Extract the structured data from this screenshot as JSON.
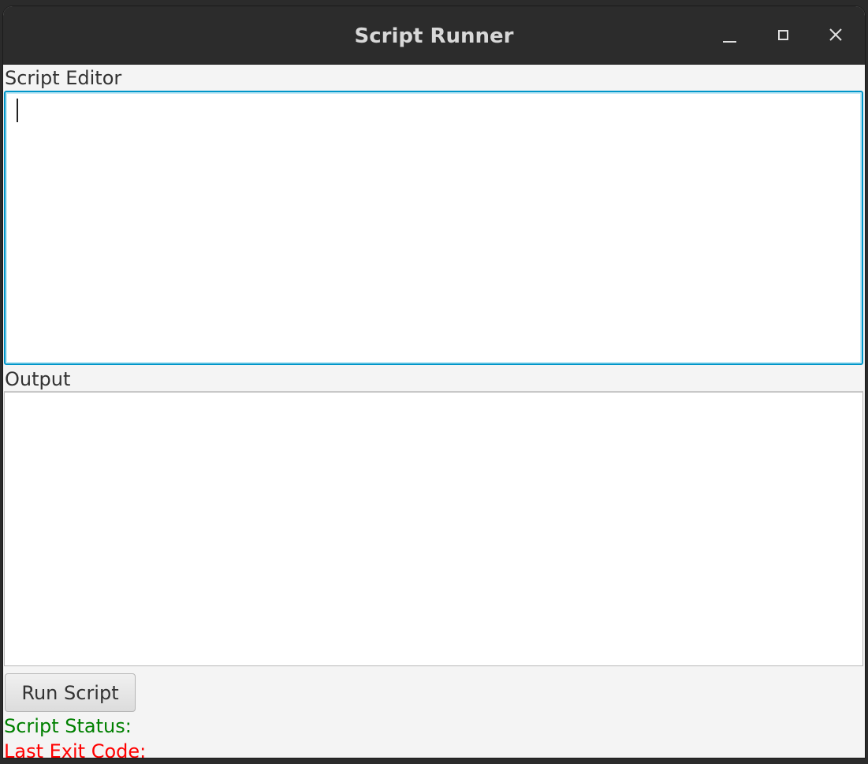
{
  "window": {
    "title": "Script Runner",
    "controls": {
      "minimize": "minimize-icon",
      "maximize": "maximize-icon",
      "close": "close-icon"
    }
  },
  "editor": {
    "label": "Script Editor",
    "value": ""
  },
  "output": {
    "label": "Output",
    "value": ""
  },
  "actions": {
    "run_label": "Run Script"
  },
  "status": {
    "script_status_label": "Script Status:",
    "script_status_value": "",
    "exit_code_label": "Last Exit Code:",
    "exit_code_value": ""
  },
  "colors": {
    "focus_accent": "#0096c9",
    "status_ok": "#008000",
    "status_error": "#ff0000",
    "titlebar": "#2c2c2c"
  }
}
